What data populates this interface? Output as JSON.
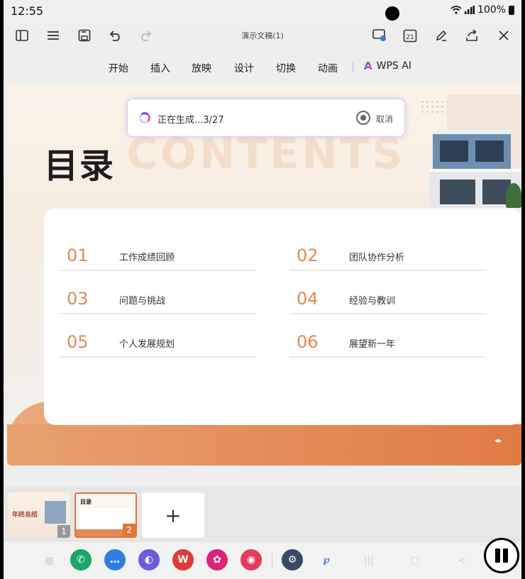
{
  "status": {
    "time": "12:55",
    "battery": "100%",
    "wifi_icon": "wifi-icon",
    "signal_icon": "signal-icon"
  },
  "toolbar": {
    "doc_title": "演示文稿(1)",
    "calendar_day": "21"
  },
  "menu": {
    "items": [
      "开始",
      "插入",
      "放映",
      "设计",
      "切换",
      "动画"
    ],
    "wps_ai": "WPS AI"
  },
  "generation": {
    "status_text": "正在生成...3/27",
    "cancel_label": "取消"
  },
  "slide": {
    "title": "目录",
    "bg_word": "CONTENTS",
    "items": [
      {
        "num": "01",
        "label": "工作成绩回顾"
      },
      {
        "num": "02",
        "label": "团队协作分析"
      },
      {
        "num": "03",
        "label": "问题与挑战"
      },
      {
        "num": "04",
        "label": "经验与教训"
      },
      {
        "num": "05",
        "label": "个人发展规划"
      },
      {
        "num": "06",
        "label": "展望新一年"
      }
    ],
    "nav_arrows": "◂▸"
  },
  "thumbnails": [
    {
      "index": "1",
      "title": "年终总结"
    },
    {
      "index": "2",
      "title": "目录"
    }
  ],
  "add_slide_label": "+",
  "colors": {
    "accent": "#e07a45",
    "toc_number": "#e08b54",
    "ai_gradient_start": "#5b5bf5",
    "ai_gradient_end": "#e6458a"
  }
}
